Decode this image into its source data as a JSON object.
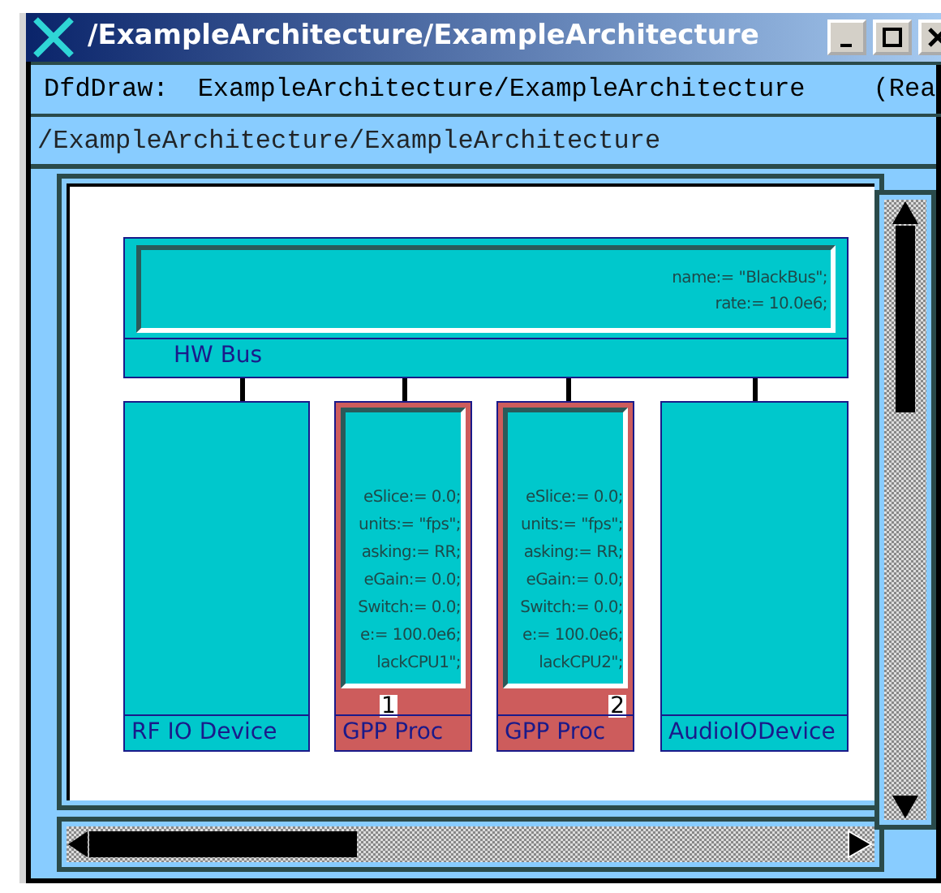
{
  "window": {
    "title": "/ExampleArchitecture/ExampleArchitecture",
    "controls": [
      {
        "kind": "minimize"
      },
      {
        "kind": "maximize"
      },
      {
        "kind": "close"
      }
    ]
  },
  "header": {
    "program": "DfdDraw:",
    "path": "ExampleArchitecture/ExampleArchitecture",
    "status": "(Rea"
  },
  "path_bar": "/ExampleArchitecture/ExampleArchitecture",
  "bus": {
    "label": "HW Bus",
    "attributes": [
      "name:= \"BlackBus\";",
      "rate:= 10.0e6;"
    ]
  },
  "devices": [
    {
      "kind": "device",
      "label": "RF IO Device"
    },
    {
      "kind": "processor",
      "label": "GPP Proc",
      "number": "1",
      "attributes": [
        "eSlice:= 0.0;",
        "units:= \"fps\";",
        "asking:= RR;",
        "eGain:= 0.0;",
        "Switch:= 0.0;",
        "e:= 100.0e6;",
        "lackCPU1\";"
      ]
    },
    {
      "kind": "processor",
      "label": "GPP Proc",
      "number": "2",
      "attributes": [
        "eSlice:= 0.0;",
        "units:= \"fps\";",
        "asking:= RR;",
        "eGain:= 0.0;",
        "Switch:= 0.0;",
        "e:= 100.0e6;",
        "lackCPU2\";"
      ]
    },
    {
      "kind": "device",
      "label": "AudioIODevice"
    }
  ]
}
